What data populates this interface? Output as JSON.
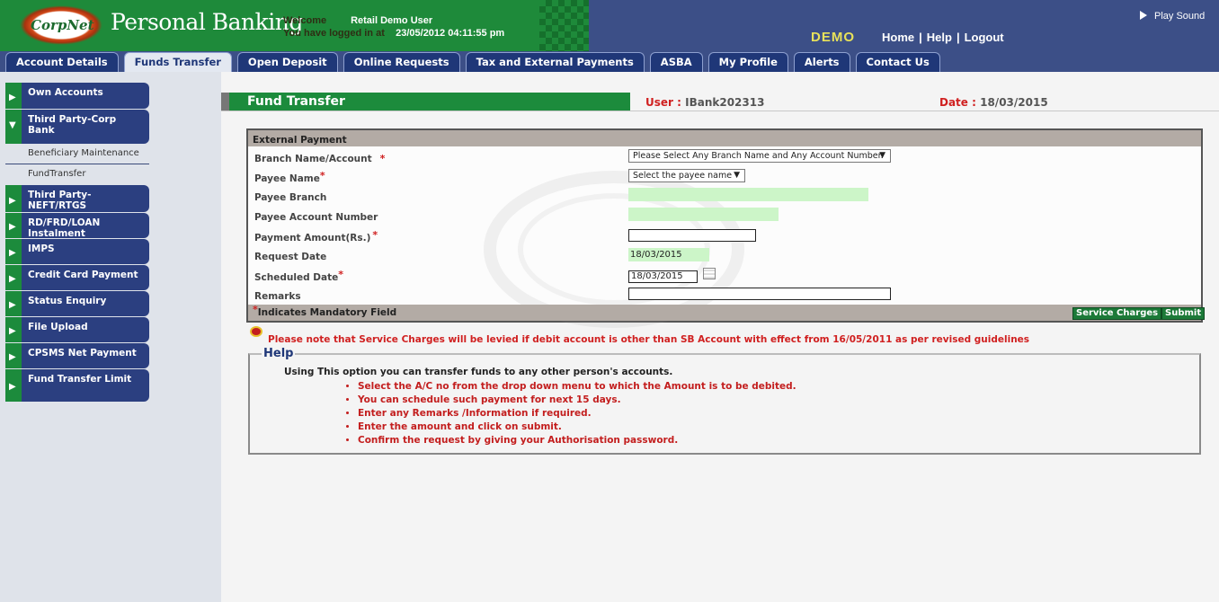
{
  "header": {
    "logo_text": "CorpNet",
    "brand": "Personal Banking",
    "welcome_label": "Welcome",
    "welcome_user": "Retail Demo User",
    "login_label": "You have logged in at",
    "login_time": "23/05/2012 04:11:55 pm",
    "demo_badge": "DEMO",
    "links": {
      "home": "Home",
      "help": "Help",
      "logout": "Logout",
      "sep": "|"
    },
    "play_sound": "Play Sound"
  },
  "tabs": [
    {
      "label": "Account Details"
    },
    {
      "label": "Funds Transfer",
      "active": true
    },
    {
      "label": "Open Deposit"
    },
    {
      "label": "Online Requests"
    },
    {
      "label": "Tax and External Payments"
    },
    {
      "label": "ASBA"
    },
    {
      "label": "My Profile"
    },
    {
      "label": "Alerts"
    },
    {
      "label": "Contact Us"
    }
  ],
  "sidebar": {
    "items": [
      {
        "label": "Own Accounts"
      },
      {
        "label": "Third Party-Corp Bank",
        "expanded": true
      },
      {
        "label": "Third Party-NEFT/RTGS"
      },
      {
        "label": "RD/FRD/LOAN Instalment"
      },
      {
        "label": "IMPS"
      },
      {
        "label": "Credit Card Payment"
      },
      {
        "label": "Status Enquiry"
      },
      {
        "label": "File Upload"
      },
      {
        "label": "CPSMS Net Payment"
      },
      {
        "label": "Fund Transfer Limit"
      }
    ],
    "subitems": [
      {
        "label": "Beneficiary Maintenance"
      },
      {
        "label": "FundTransfer"
      }
    ]
  },
  "page": {
    "title": "Fund Transfer",
    "user_label": "User :",
    "user_value": "IBank202313",
    "date_label": "Date :",
    "date_value": "18/03/2015"
  },
  "form": {
    "section_title": "External Payment",
    "labels": {
      "branch_account": "Branch Name/Account",
      "payee_name": "Payee Name",
      "payee_branch": "Payee Branch",
      "payee_account_number": "Payee Account Number",
      "payment_amount": "Payment Amount(Rs.)",
      "request_date": "Request Date",
      "scheduled_date": "Scheduled Date",
      "remarks": "Remarks"
    },
    "required_marker": "*",
    "branch_select_value": "Please Select Any Branch Name and Any Account Number.",
    "payee_select_value": "Select the payee name",
    "request_date_value": "18/03/2015",
    "scheduled_date_value": "18/03/2015",
    "mandatory_note": "Indicates Mandatory Field",
    "buttons": {
      "service_charges": "Service Charges",
      "submit": "Submit"
    }
  },
  "notice": "Please note that Service Charges will be levied if debit account is other than SB Account with effect from 16/05/2011 as per revised guidelines",
  "help": {
    "title": "Help",
    "intro": "Using This option you can transfer funds to any other person's accounts.",
    "points": [
      "Select the A/C no from the drop down menu to which the Amount is to be debited.",
      "You can schedule such payment for next 15 days.",
      "Enter any Remarks /Information if required.",
      "Enter the amount and click on submit.",
      "Confirm the request by giving your Authorisation password."
    ]
  }
}
